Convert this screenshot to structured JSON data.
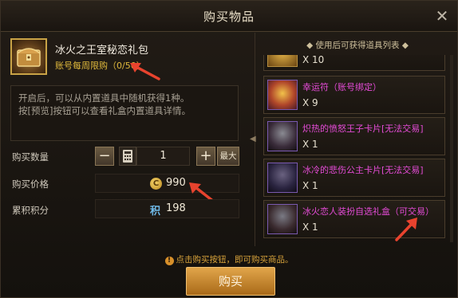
{
  "window": {
    "title": "购买物品",
    "close_label": "✕"
  },
  "item": {
    "name": "冰火之王室秘恋礼包",
    "limit_text": "账号每周限购（0/50）",
    "description_lines": [
      "开启后，可以从内置道具中随机获得1种。",
      "按[预览]按钮可以查看礼盒内置道具详情。"
    ]
  },
  "purchase": {
    "quantity_label": "购买数量",
    "minus_label": "−",
    "quantity_value": "1",
    "plus_label": "+",
    "max_label": "最大",
    "price_label": "购买价格",
    "currency_symbol": "C",
    "price_value": "990",
    "points_label": "累积积分",
    "points_symbol": "积",
    "points_value": "198"
  },
  "rewards_panel": {
    "title": "◆ 使用后可获得道具列表 ◆",
    "items": [
      {
        "name": "",
        "qty": "X 10",
        "icon": "gold-item-icon"
      },
      {
        "name": "幸运符（账号绑定）",
        "qty": "X 9",
        "icon": "lucky-charm-icon"
      },
      {
        "name": "炽热的愤怒王子卡片[无法交易]",
        "qty": "X 1",
        "icon": "prince-card-icon"
      },
      {
        "name": "冰冷的悲伤公主卡片[无法交易]",
        "qty": "X 1",
        "icon": "princess-card-icon"
      },
      {
        "name": "冰火恋人装扮自选礼盒（可交易）",
        "qty": "X 1",
        "icon": "outfit-box-icon"
      }
    ]
  },
  "footer": {
    "note": "点击购买按钮，即可购买商品。",
    "buy_label": "购买"
  },
  "colors": {
    "accent": "#e0b93c",
    "item_name": "#e44bd6",
    "annotation_arrow": "#e8432e"
  }
}
